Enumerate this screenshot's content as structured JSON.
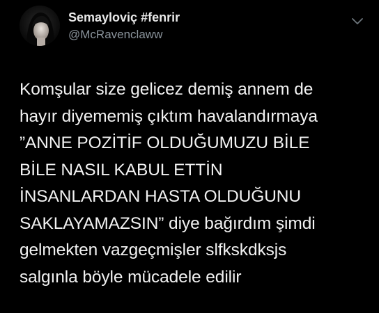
{
  "tweet": {
    "author": {
      "display_name": "Semayloviç #fenrir",
      "handle": "@McRavenclaww",
      "avatar_icon": "user-avatar"
    },
    "menu_icon": "chevron-down-icon",
    "lines": [
      "Komşular size gelicez demiş annem de",
      "hayır diyememiş çıktım havalandırmaya",
      "”ANNE POZİTİF OLDUĞUMUZU BİLE",
      "BİLE NASIL KABUL ETTİN",
      "İNSANLARDAN HASTA OLDUĞUNU",
      "SAKLAYAMAZSIN” diye bağırdım şimdi",
      "gelmekten vazgeçmişler slfkskdksjs",
      "salgınla böyle mücadele edilir"
    ]
  },
  "colors": {
    "background": "#000000",
    "text": "#f1f1f1",
    "secondary_text": "#8a939b"
  }
}
